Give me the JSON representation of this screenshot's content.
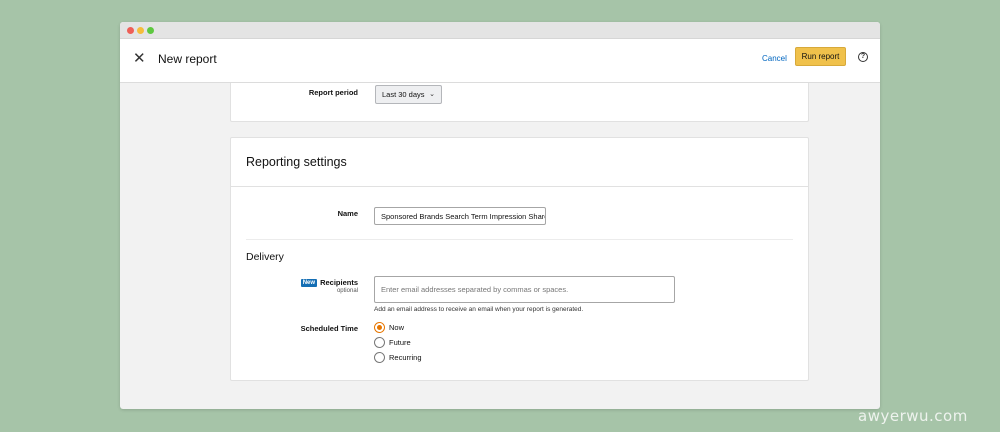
{
  "header": {
    "title": "New report",
    "cancel_label": "Cancel",
    "run_label": "Run report",
    "help_icon_glyph": "?"
  },
  "report_period": {
    "label": "Report period",
    "selected": "Last 30 days"
  },
  "reporting_settings": {
    "title": "Reporting settings",
    "name_label": "Name",
    "name_value": "Sponsored Brands Search Term Impression Share report"
  },
  "delivery": {
    "title": "Delivery",
    "badge": "New",
    "recipients_label": "Recipients",
    "recipients_optional": "optional",
    "recipients_placeholder": "Enter email addresses separated by commas or spaces.",
    "recipients_hint": "Add an email address to receive an email when your report is generated.",
    "scheduled_label": "Scheduled Time",
    "options": [
      "Now",
      "Future",
      "Recurring"
    ],
    "selected_index": 0
  },
  "watermark": "awyerwu.com",
  "colors": {
    "accent_button": "#f0c14b",
    "link": "#0066c0",
    "radio_selected": "#e77600",
    "badge": "#146eb4",
    "background": "#a6c4a8"
  }
}
